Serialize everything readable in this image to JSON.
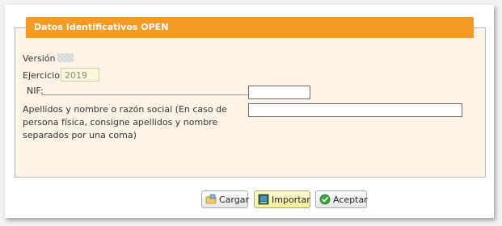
{
  "header": {
    "title": "Datos Identificativos OPEN"
  },
  "form": {
    "version_label": "Versión",
    "ejercicio_label": "Ejercicio",
    "ejercicio_value": "2019",
    "nif_label": "NIF:",
    "nif_value": "",
    "nombre_label": "Apellidos y nombre o razón social (En caso de persona física, consigne apellidos y nombre separados por una coma)",
    "nombre_value": ""
  },
  "buttons": {
    "cargar": "Cargar",
    "importar": "Importar",
    "aceptar": "Aceptar"
  },
  "icons": {
    "cargar": "folder-load-icon",
    "importar": "import-icon",
    "aceptar": "check-icon"
  },
  "colors": {
    "header_bg": "#f59a23",
    "panel_bg": "#fdf3e7",
    "active_button_bg": "#f6ef9c",
    "check_green": "#3aa53a"
  }
}
